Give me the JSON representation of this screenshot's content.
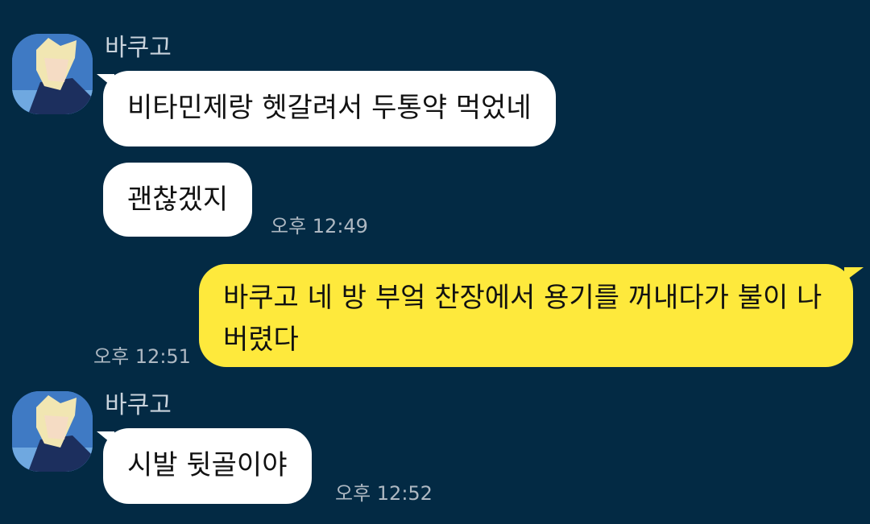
{
  "chat": {
    "messages": [
      {
        "sender": "바쿠고",
        "texts": [
          "비타민제랑 헷갈려서 두통약 먹었네",
          "괜찮겠지"
        ],
        "time": "오후 12:49"
      },
      {
        "sender": "me",
        "text": "바쿠고 네 방 부엌 찬장에서 용기를 꺼내다가 불이 나버렸다",
        "time": "오후 12:51"
      },
      {
        "sender": "바쿠고",
        "text": "시발 뒷골이야",
        "time": "오후 12:52"
      }
    ]
  },
  "colors": {
    "background": "#032a44",
    "incoming_bubble": "#ffffff",
    "outgoing_bubble": "#fee93c"
  },
  "icons": {
    "avatar": "profile-picture-icon"
  }
}
